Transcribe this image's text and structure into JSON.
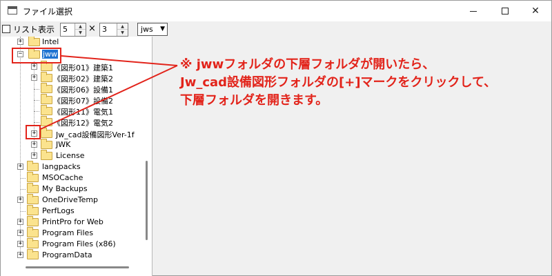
{
  "window": {
    "title": "ファイル選択"
  },
  "toolbar": {
    "list_label": "リスト表示",
    "cols_value": "5",
    "times": "×",
    "rows_value": "3",
    "ext_value": "jws",
    "spin_up": "▲",
    "spin_down": "▼",
    "combo_arrow": "▼"
  },
  "tree": {
    "intel": "Intel",
    "jww": "jww",
    "fig01": "《図形01》建築1",
    "fig02": "《図形02》建築2",
    "fig06": "《図形06》設備1",
    "fig07": "《図形07》設備2",
    "fig11": "《図形11》電気1",
    "fig12": "《図形12》電気2",
    "jwcad": "Jw_cad設備図形Ver-1f",
    "jwk": "JWK",
    "license": "License",
    "langpacks": "langpacks",
    "msocache": "MSOCache",
    "mybackups": "My Backups",
    "onedrivetemp": "OneDriveTemp",
    "perflogs": "PerfLogs",
    "printpro": "PrintPro for Web",
    "programfiles": "Program Files",
    "programfilesx86": "Program Files (x86)",
    "programdata": "ProgramData",
    "plus": "+",
    "minus": "−"
  },
  "callout": {
    "line1": "※ jwwフォルダの下層フォルダが開いたら、",
    "line2": "Jw_cad設備図形フォルダの[+]マークをクリックして、",
    "line3": "下層フォルダを開きます。"
  },
  "colors": {
    "annotation": "#e2231a",
    "selection": "#1f73d1",
    "folder": "#fbe38e"
  }
}
